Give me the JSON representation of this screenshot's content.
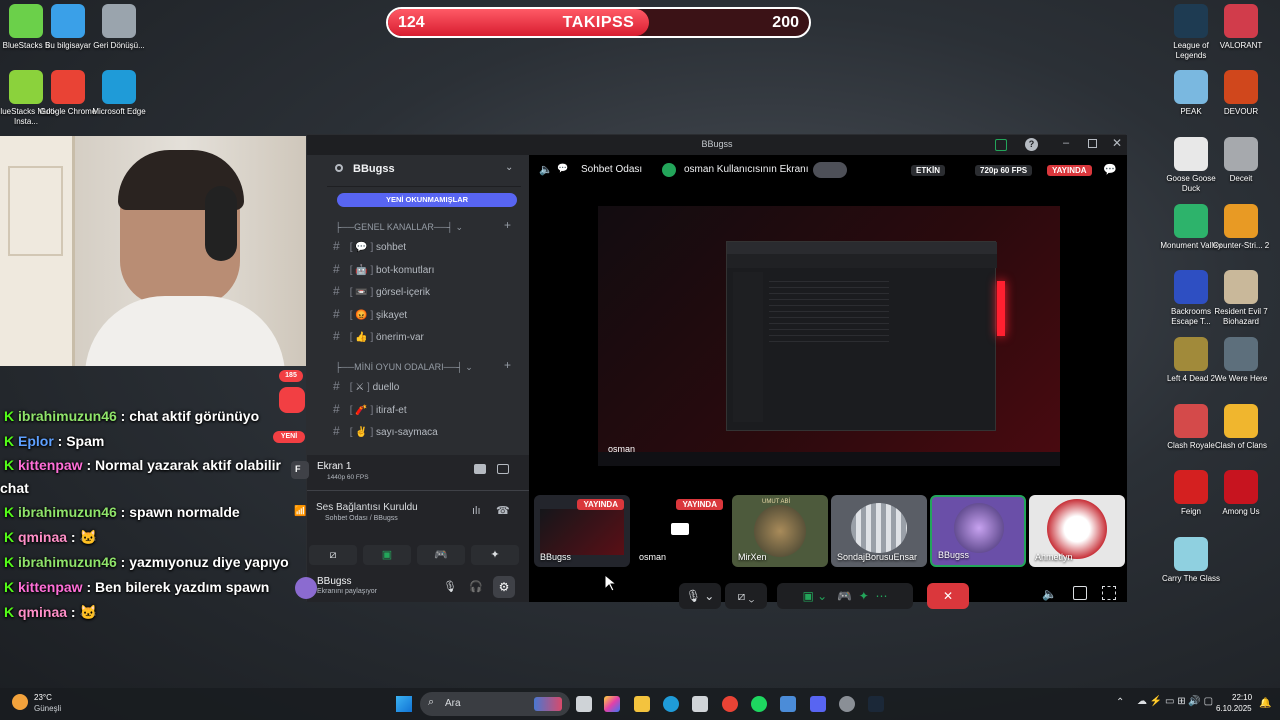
{
  "follower_goal": {
    "current": "124",
    "label": "TAKIPSS",
    "target": "200",
    "progress": 0.62
  },
  "desktop_left": [
    {
      "label": "BlueStacks 5",
      "color": "#6bd04a"
    },
    {
      "label": "Bu bilgisayar",
      "color": "#3aa0e8"
    },
    {
      "label": "Geri Dönüşü...",
      "color": "#9aa4ad"
    },
    {
      "label": "BlueStacks Multi-Insta...",
      "color": "#8bd23c"
    },
    {
      "label": "Google Chrome",
      "color": "#e94335"
    },
    {
      "label": "Microsoft Edge",
      "color": "#1f9bd8"
    }
  ],
  "desktop_right": [
    {
      "label": "League of Legends",
      "color": "#1e3b52"
    },
    {
      "label": "VALORANT",
      "color": "#d13c4b"
    },
    {
      "label": "PEAK",
      "color": "#7ab8e0"
    },
    {
      "label": "DEVOUR",
      "color": "#d0471c"
    },
    {
      "label": "Goose Goose Duck",
      "color": "#e8e8e8"
    },
    {
      "label": "Deceit",
      "color": "#a6a9ad"
    },
    {
      "label": "Monument Valley",
      "color": "#2db36b"
    },
    {
      "label": "Counter-Stri... 2",
      "color": "#e89a24"
    },
    {
      "label": "Backrooms Escape T...",
      "color": "#2e4fc2"
    },
    {
      "label": "Resident Evil 7 Biohazard",
      "color": "#c9b89a"
    },
    {
      "label": "Left 4 Dead 2",
      "color": "#a18a3a"
    },
    {
      "label": "We Were Here",
      "color": "#5d6f7c"
    },
    {
      "label": "Clash Royale",
      "color": "#d44a4a"
    },
    {
      "label": "Clash of Clans",
      "color": "#f0b62e"
    },
    {
      "label": "Feign",
      "color": "#d42020"
    },
    {
      "label": "Among Us",
      "color": "#c7141f"
    },
    {
      "label": "Carry The Glass",
      "color": "#8fd0e0"
    }
  ],
  "chat": [
    {
      "user": "ibrahimuzun46",
      "color": "#8fe36a",
      "msg": " : chat aktif görünüyo"
    },
    {
      "user": "Eplor",
      "color": "#5ea0ff",
      "msg": " : Spam"
    },
    {
      "user": "kittenpaw",
      "color": "#ff6fd8",
      "msg": " : Normal yazarak aktif olabilir chat"
    },
    {
      "user": "ibrahimuzun46",
      "color": "#8fe36a",
      "msg": " : spawn normalde"
    },
    {
      "user": "qminaa",
      "color": "#ff8fc8",
      "msg": " : 🐱"
    },
    {
      "user": "ibrahimuzun46",
      "color": "#8fe36a",
      "msg": " : yazmıyonuz diye yapıyo"
    },
    {
      "user": "kittenpaw",
      "color": "#ff6fd8",
      "msg": " : Ben bilerek yazdım spawn"
    },
    {
      "user": "qminaa",
      "color": "#ff8fc8",
      "msg": " : 🐱"
    }
  ],
  "discord": {
    "window_title": "BBugss",
    "server_name": "BBugss",
    "unread_banner": "YENİ OKUNMAMIŞLAR",
    "cat1": "GENEL KANALLAR",
    "cat2": "MİNİ OYUN ODALARI",
    "channels1": [
      {
        "emoji": "💬",
        "name": "sohbet"
      },
      {
        "emoji": "🤖",
        "name": "bot-komutları"
      },
      {
        "emoji": "📼",
        "name": "görsel-içerik"
      },
      {
        "emoji": "😡",
        "name": "şikayet"
      },
      {
        "emoji": "👍",
        "name": "önerim-var"
      }
    ],
    "channels2": [
      {
        "emoji": "⚔",
        "name": "duello"
      },
      {
        "emoji": "🧨",
        "name": "itiraf-et"
      },
      {
        "emoji": "✌",
        "name": "sayı-saymaca"
      }
    ],
    "guild_badge": "185",
    "guild_new": "YENİ",
    "screen_panel": {
      "title": "Ekran 1",
      "sub": "1440p 60 FPS",
      "avatar_letter": "F"
    },
    "voice_panel": {
      "title": "Ses Bağlantısı Kuruldu",
      "sub": "Sohbet Odası / BBugss"
    },
    "user_panel": {
      "name": "BBugss",
      "status": "Ekranını paylaşıyor"
    },
    "header": {
      "voice_channel": "Sohbet Odası",
      "stream_title": "osman Kullanıcısının Ekranı",
      "active_label": "ETKİN",
      "quality": "720p 60 FPS",
      "live": "YAYINDA"
    },
    "stream_owner": "osman",
    "participants": [
      {
        "name": "BBugss",
        "live": "YAYINDA",
        "bg": "#23252c"
      },
      {
        "name": "osman",
        "live": "YAYINDA",
        "bg": "#000000"
      },
      {
        "name": "MirXen",
        "live": "",
        "bg": "#4d5a3c"
      },
      {
        "name": "SondajBorusuEnsar",
        "live": "",
        "bg": "#5a5e66"
      },
      {
        "name": "BBugss",
        "live": "",
        "bg": "#6a4fa8"
      },
      {
        "name": "Ahmetlyn",
        "live": "",
        "bg": "#e7e7e7"
      }
    ],
    "mirxen_tag": "UMUT ABİ"
  },
  "taskbar": {
    "weather_temp": "23°C",
    "weather_desc": "Güneşli",
    "search_placeholder": "Ara",
    "time": "22:10",
    "date": "6.10.2025"
  }
}
